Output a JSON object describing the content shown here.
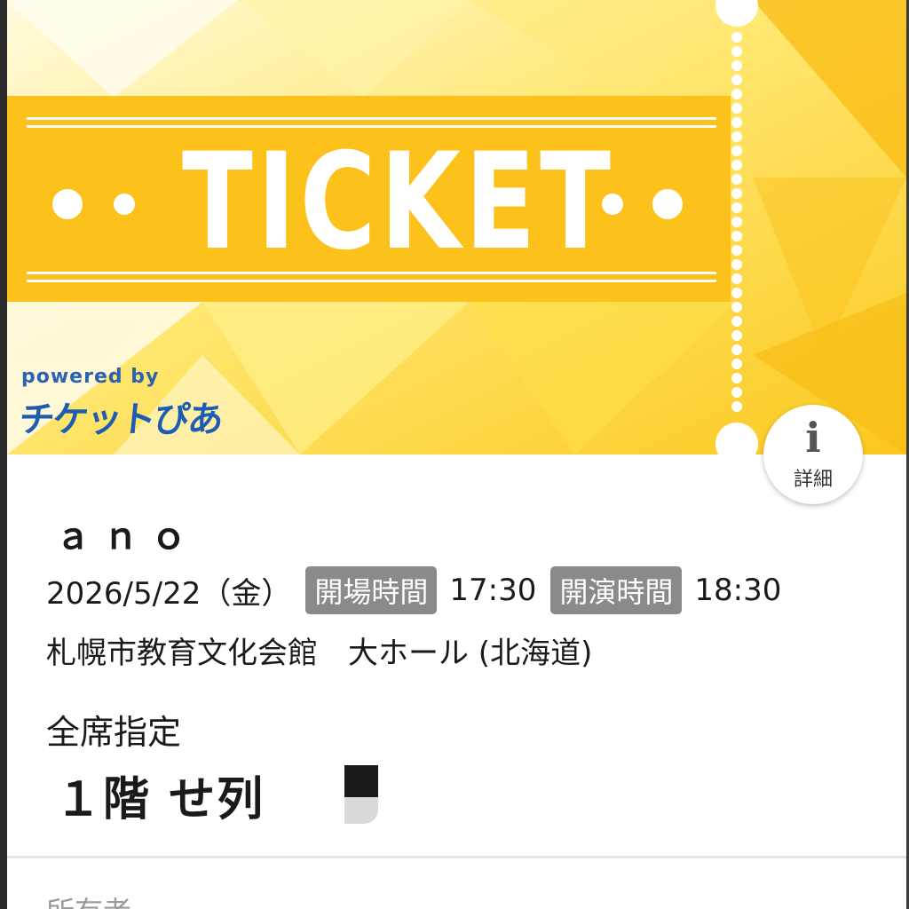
{
  "banner": {
    "ticket_text": "TICKET",
    "powered_by": "powered by",
    "brand": "チケットぴあ",
    "colors": {
      "yellow_main": "#fcc21b",
      "yellow_light": "#fff4b0",
      "brand_blue": "#1e5cb3"
    }
  },
  "info_button": {
    "icon": "i",
    "label": "詳細"
  },
  "event": {
    "artist": "ａｎｏ",
    "date": "2026/5/22（金）",
    "open_label": "開場時間",
    "open_time": "17:30",
    "start_label": "開演時間",
    "start_time": "18:30",
    "venue": "札幌市教育文化会館　大ホール (北海道)"
  },
  "seat": {
    "type": "全席指定",
    "location": "１階 せ列"
  },
  "owner": {
    "label": "所有者"
  }
}
